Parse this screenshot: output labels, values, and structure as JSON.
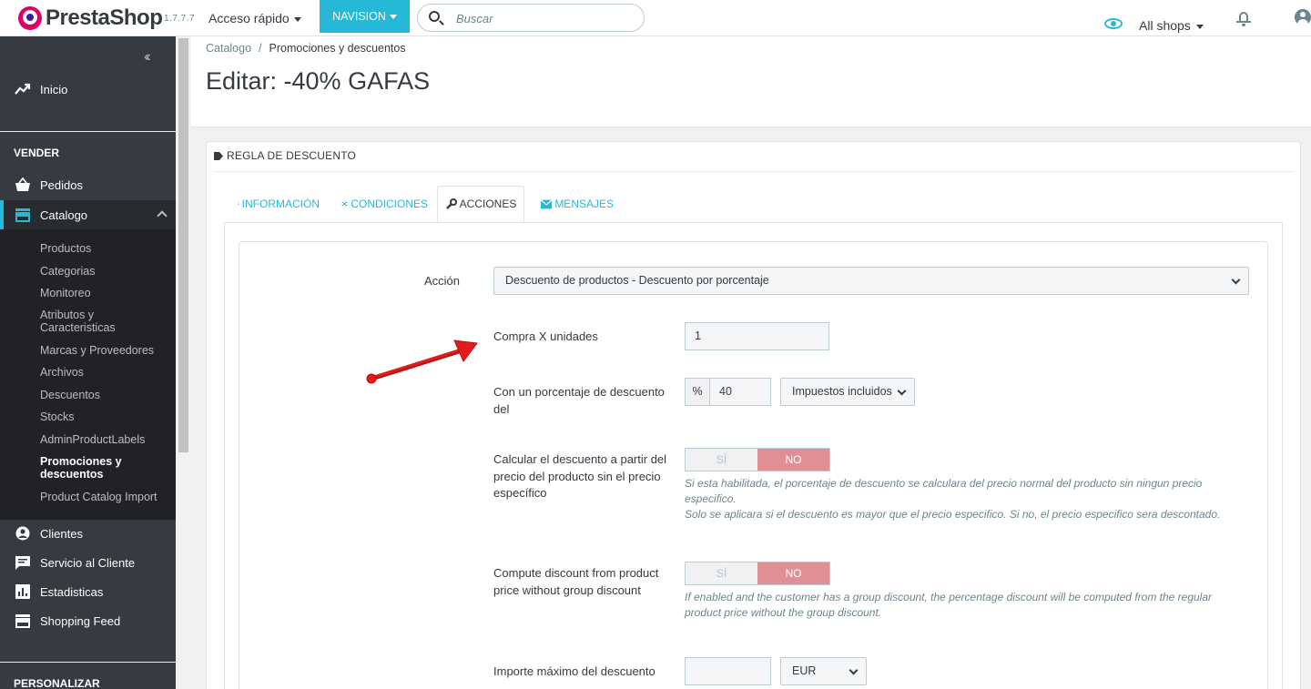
{
  "topbar": {
    "brand": "PrestaShop",
    "version": "1.7.7.7",
    "quick_access": "Acceso rápido",
    "nav_button": "NAVISION",
    "search_placeholder": "Buscar",
    "shop_selector": "All shops"
  },
  "sidebar": {
    "home": "Inicio",
    "section_sell": "VENDER",
    "orders": "Pedidos",
    "catalog": "Catalogo",
    "catalog_items": [
      "Productos",
      "Categorias",
      "Monitoreo",
      "Atributos y Caracteristicas",
      "Marcas y Proveedores",
      "Archivos",
      "Descuentos",
      "Stocks",
      "AdminProductLabels",
      "Promociones y descuentos",
      "Product Catalog Import"
    ],
    "customers": "Clientes",
    "customer_service": "Servicio al Cliente",
    "stats": "Estadisticas",
    "shopping_feed": "Shopping Feed",
    "section_customize": "PERSONALIZAR"
  },
  "breadcrumb": {
    "parent": "Catalogo",
    "separator": "/",
    "current": "Promociones y descuentos"
  },
  "page_title": "Editar: -40% GAFAS",
  "panel": {
    "heading": "REGLA DE DESCUENTO",
    "tabs": [
      "INFORMACIÓN",
      "CONDICIONES",
      "ACCIONES",
      "MENSAJES"
    ]
  },
  "form": {
    "action_label": "Acción",
    "action_value": "Descuento de productos - Descuento por porcentaje",
    "buy_x_label": "Compra X unidades",
    "buy_x_value": "1",
    "percent_label": "Con un porcentaje de descuento del",
    "percent_addon": "%",
    "percent_value": "40",
    "tax_value": "Impuestos incluidos",
    "calc_label": "Calcular el descuento a partir del precio del producto sin el precio específico",
    "calc_yes": "SÍ",
    "calc_no": "NO",
    "calc_help_1": "Si esta habilitada, el porcentaje de descuento se calculara del precio normal del producto sin ningun precio especifico.",
    "calc_help_2": "Solo se aplicara si el descuento es mayor que el precio especifico. Si no, el precio especifico sera descontado.",
    "group_label": "Compute discount from product price without group discount",
    "group_yes": "SÍ",
    "group_no": "NO",
    "group_help": "If enabled and the customer has a group discount, the percentage discount will be computed from the regular product price without the group discount.",
    "max_label": "Importe máximo del descuento",
    "max_value": "",
    "currency_value": "EUR"
  },
  "colors": {
    "accent": "#25b9d7",
    "sidebar_bg": "#363a41",
    "switch_no": "#e08f95",
    "arrow": "#e31b1b"
  }
}
